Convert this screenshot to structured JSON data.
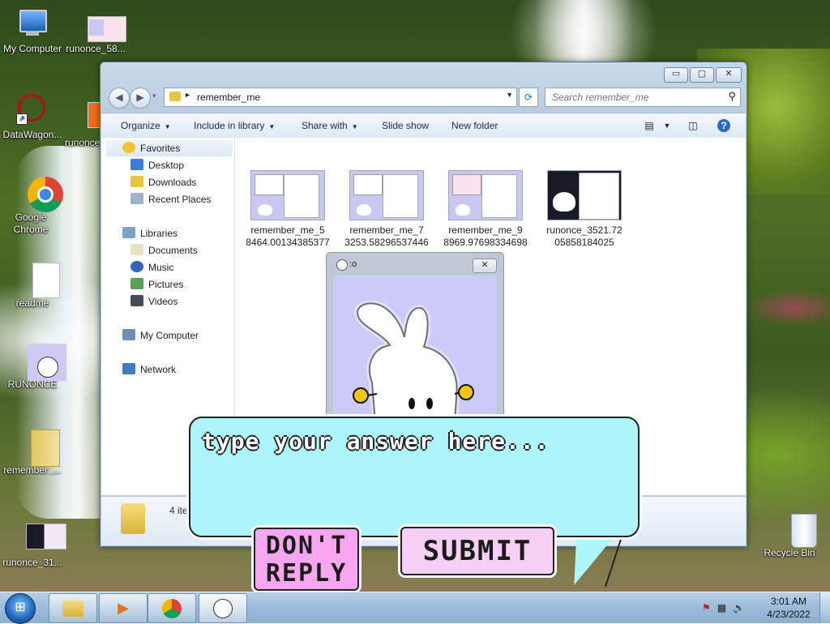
{
  "desktop": {
    "icons": [
      {
        "label": "My Computer"
      },
      {
        "label": "runonce_58..."
      },
      {
        "label": "DataWagon..."
      },
      {
        "label": "runonce_..."
      },
      {
        "label": "Google Chrome"
      },
      {
        "label": "readme"
      },
      {
        "label": "RUNONCE"
      },
      {
        "label": "remember_..."
      },
      {
        "label": "runonce_31..."
      },
      {
        "label": "Recycle Bin"
      }
    ]
  },
  "explorer": {
    "address_path": "remember_me",
    "search_placeholder": "Search remember_me",
    "caption": {
      "minimize": "▭",
      "maximize": "▢",
      "close": "✕"
    },
    "toolbar": {
      "organize": "Organize",
      "include_in_library": "Include in library",
      "share_with": "Share with",
      "slide_show": "Slide show",
      "new_folder": "New folder"
    },
    "nav": {
      "favorites": "Favorites",
      "desktop": "Desktop",
      "downloads": "Downloads",
      "recent_places": "Recent Places",
      "libraries": "Libraries",
      "documents": "Documents",
      "music": "Music",
      "pictures": "Pictures",
      "videos": "Videos",
      "my_computer": "My Computer",
      "network": "Network"
    },
    "files": [
      {
        "line1": "remember_me_5",
        "line2": "8464.00134385377"
      },
      {
        "line1": "remember_me_7",
        "line2": "3253.58296537446"
      },
      {
        "line1": "remember_me_9",
        "line2": "8969.97698334698"
      },
      {
        "line1": "runonce_3521.72",
        "line2": "05858184025"
      }
    ],
    "status_count": "4 ite"
  },
  "popup": {
    "title": ":o",
    "close": "✕"
  },
  "chat": {
    "placeholder": "type your answer here...",
    "dont_reply_line1": "DON'T",
    "dont_reply_line2": "REPLY",
    "submit": "SUBMIT"
  },
  "taskbar": {
    "time": "3:01 AM",
    "date": "4/23/2022"
  }
}
